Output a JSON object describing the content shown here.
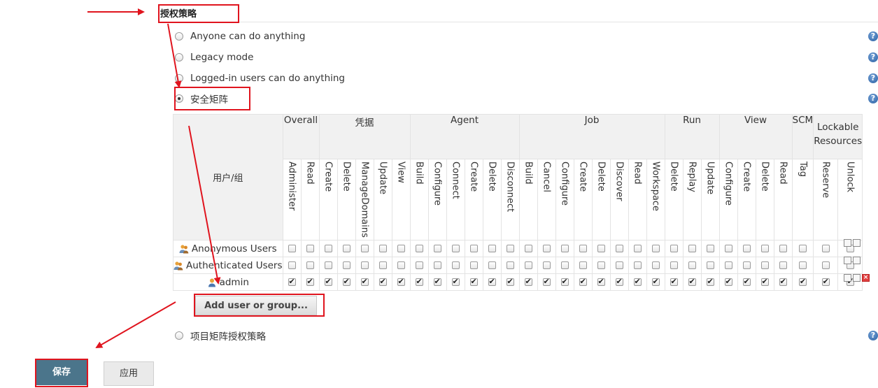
{
  "section_title": "授权策略",
  "options": [
    {
      "label": "Anyone can do anything",
      "checked": false
    },
    {
      "label": "Legacy mode",
      "checked": false
    },
    {
      "label": "Logged-in users can do anything",
      "checked": false
    },
    {
      "label": "安全矩阵",
      "checked": true
    }
  ],
  "last_option": {
    "label": "项目矩阵授权策略",
    "checked": false
  },
  "help_icon": "?",
  "matrix": {
    "corner_label": "用户/组",
    "groups": [
      {
        "label": "Overall",
        "perms": [
          "Administer",
          "Read"
        ]
      },
      {
        "label": "凭据",
        "perms": [
          "Create",
          "Delete",
          "ManageDomains",
          "Update",
          "View"
        ]
      },
      {
        "label": "Agent",
        "perms": [
          "Build",
          "Configure",
          "Connect",
          "Create",
          "Delete",
          "Disconnect"
        ]
      },
      {
        "label": "Job",
        "perms": [
          "Build",
          "Cancel",
          "Configure",
          "Create",
          "Delete",
          "Discover",
          "Read",
          "Workspace"
        ]
      },
      {
        "label": "Run",
        "perms": [
          "Delete",
          "Replay",
          "Update"
        ]
      },
      {
        "label": "View",
        "perms": [
          "Configure",
          "Create",
          "Delete",
          "Read"
        ]
      },
      {
        "label": "SCM",
        "perms": [
          "Tag"
        ]
      },
      {
        "label": "Lockable Resources",
        "perms": [
          "Reserve",
          "Unlock"
        ]
      }
    ],
    "rows": [
      {
        "name": "Anonymous Users",
        "icon": "group-icon",
        "all_checked": false,
        "deletable": false
      },
      {
        "name": "Authenticated Users",
        "icon": "group-icon",
        "all_checked": false,
        "deletable": false
      },
      {
        "name": "admin",
        "icon": "user-icon",
        "all_checked": true,
        "deletable": true
      }
    ]
  },
  "add_button_label": "Add user or group...",
  "save_label": "保存",
  "apply_label": "应用",
  "colors": {
    "save_bg": "#4b758b",
    "annotation": "#e0141e",
    "help": "#2e62a3"
  }
}
